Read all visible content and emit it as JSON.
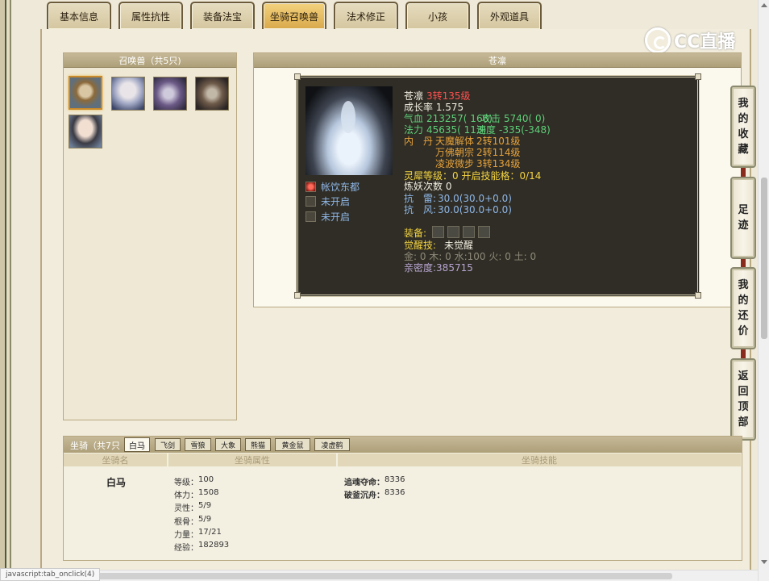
{
  "tabs": [
    {
      "label": "基本信息",
      "active": false
    },
    {
      "label": "属性抗性",
      "active": false
    },
    {
      "label": "装备法宝",
      "active": false
    },
    {
      "label": "坐骑召唤兽",
      "active": true
    },
    {
      "label": "法术修正",
      "active": false
    },
    {
      "label": "小孩",
      "active": false
    },
    {
      "label": "外观道具",
      "active": false
    }
  ],
  "watermark": {
    "text": "CC直播"
  },
  "summon_list": {
    "title": "召唤兽（共5只)"
  },
  "detail": {
    "title": "苍凛",
    "name": "苍凛",
    "level": "3转135级",
    "growth": "成长率 1.575",
    "hp_label": "气血",
    "hp_value": "213257( 168)",
    "atk_label": "攻击",
    "atk_value": "5740( 0)",
    "mp_label": "法力",
    "mp_value": "45635( 113)",
    "speed_label": "速度",
    "speed_value": "-335(-348)",
    "neidan_label": "内　丹",
    "neidan": [
      {
        "name": "天魔解体",
        "level": "2转101级"
      },
      {
        "name": "万佛朝宗",
        "level": "2转114级"
      },
      {
        "name": "凌波微步",
        "level": "3转134级"
      }
    ],
    "lingxi": "灵犀等级：0 开启技能格：0/14",
    "lianyao": "炼妖次数 0",
    "res_thunder_label": "抗　雷:",
    "res_thunder_value": "30.0(30.0+0.0)",
    "res_wind_label": "抗　风:",
    "res_wind_value": "30.0(30.0+0.0)",
    "equip_label": "装备:",
    "awaken_label": "觉醒技:",
    "awaken_value": "未觉醒",
    "elements": "金: 0 木: 0 水:100 火: 0 土: 0",
    "intimacy": "亲密度:385715",
    "skills": [
      {
        "label": "帐饮东都",
        "icon": "red-flame-icon"
      },
      {
        "label": "未开启",
        "icon": "locked-slot-icon"
      },
      {
        "label": "未开启",
        "icon": "locked-slot-icon"
      }
    ]
  },
  "side_buttons": [
    {
      "label": "我的收藏",
      "chars": [
        "我",
        "的",
        "收",
        "藏"
      ]
    },
    {
      "label": "足迹",
      "chars": [
        "足",
        "迹"
      ]
    },
    {
      "label": "我的还价",
      "chars": [
        "我",
        "的",
        "还",
        "价"
      ]
    },
    {
      "label": "返回顶部",
      "chars": [
        "返",
        "回",
        "顶",
        "部"
      ]
    }
  ],
  "mounts": {
    "title": "坐骑（共7只",
    "tabs": [
      "白马",
      "飞剑",
      "雪狼",
      "大象",
      "熊猫",
      "黄金鼠",
      "凌虚鹤"
    ],
    "active_tab": "白马",
    "col_name": "坐骑名",
    "col_attr": "坐骑属性",
    "col_skill": "坐骑技能",
    "name": "白马",
    "attrs": [
      {
        "label": "等级：",
        "value": "100"
      },
      {
        "label": "体力：",
        "value": "1508"
      },
      {
        "label": "灵性：",
        "value": "5/9"
      },
      {
        "label": "根骨：",
        "value": "5/9"
      },
      {
        "label": "力量：",
        "value": "17/21"
      },
      {
        "label": "经验：",
        "value": "182893"
      }
    ],
    "skills": [
      {
        "label": "追魂夺命：",
        "value": "8336"
      },
      {
        "label": "破釜沉舟：",
        "value": "8336"
      }
    ]
  },
  "statusbar": {
    "text": "javascript:tab_onclick(4)"
  }
}
